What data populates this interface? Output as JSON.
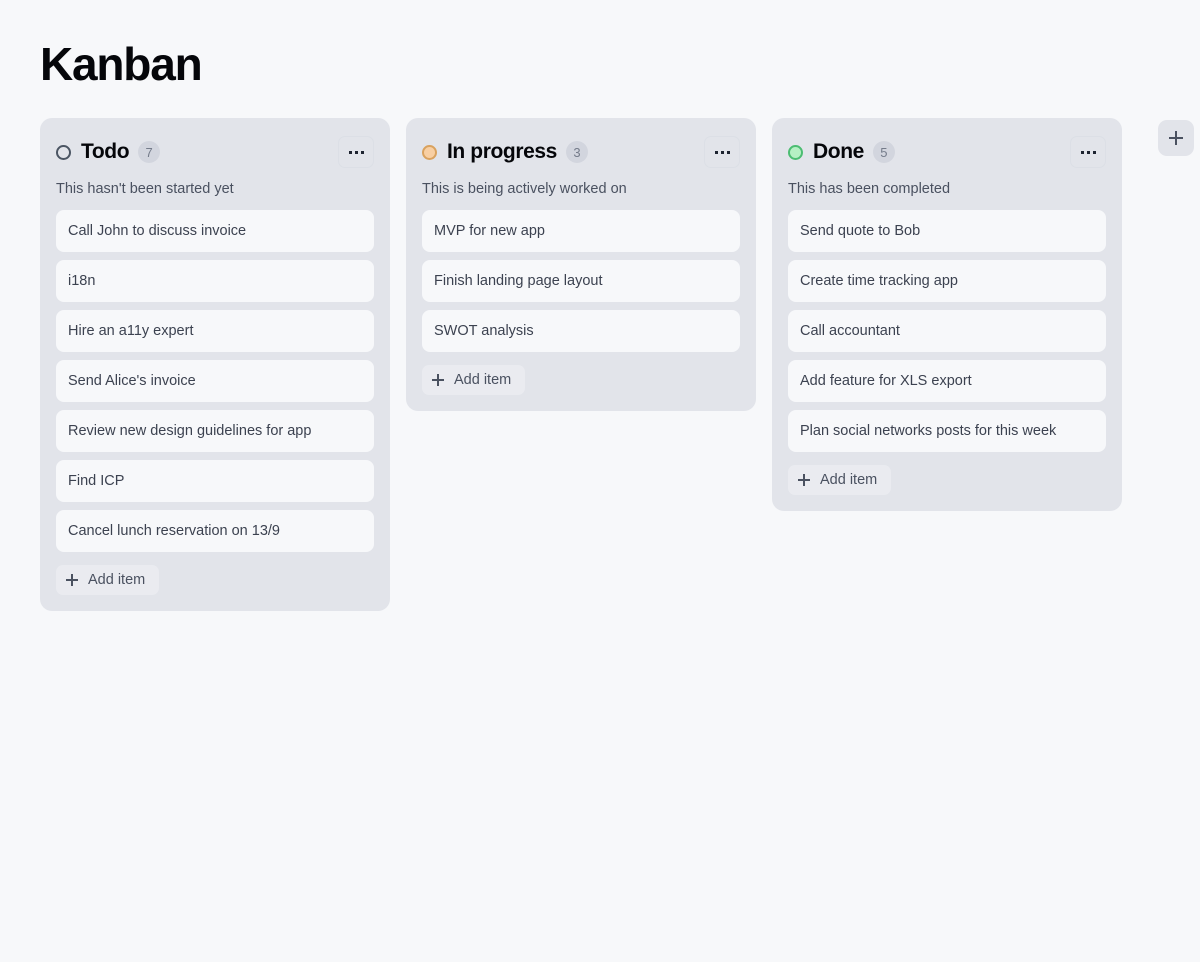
{
  "page": {
    "title": "Kanban",
    "background_color": "#f7f8fa",
    "column_color": "#e2e4ea",
    "card_color": "#f7f8fa"
  },
  "add_column_button": {
    "icon": "plus-icon",
    "label": "+"
  },
  "columns": [
    {
      "id": "todo",
      "title": "Todo",
      "count": "7",
      "description": "This hasn't been started yet",
      "status_icon": "circle-outline-icon",
      "status_color": "#4b5563",
      "menu_icon": "ellipsis-icon",
      "add_item_label": "Add item",
      "add_item_icon": "plus-icon",
      "cards": [
        "Call John to discuss invoice",
        "i18n",
        "Hire an a11y expert",
        "Send Alice's invoice",
        "Review new design guidelines for app",
        "Find ICP",
        "Cancel lunch reservation on 13/9"
      ]
    },
    {
      "id": "in-progress",
      "title": "In progress",
      "count": "3",
      "description": "This is being actively worked on",
      "status_icon": "circle-filled-orange-icon",
      "status_color": "#f8cfa3",
      "menu_icon": "ellipsis-icon",
      "add_item_label": "Add item",
      "add_item_icon": "plus-icon",
      "cards": [
        "MVP for new app",
        "Finish landing page layout",
        "SWOT analysis"
      ]
    },
    {
      "id": "done",
      "title": "Done",
      "count": "5",
      "description": "This has been completed",
      "status_icon": "circle-filled-green-icon",
      "status_color": "#b6f0c4",
      "menu_icon": "ellipsis-icon",
      "add_item_label": "Add item",
      "add_item_icon": "plus-icon",
      "cards": [
        "Send quote to Bob",
        "Create time tracking app",
        "Call accountant",
        "Add feature for XLS export",
        "Plan social networks posts for this week"
      ]
    }
  ]
}
